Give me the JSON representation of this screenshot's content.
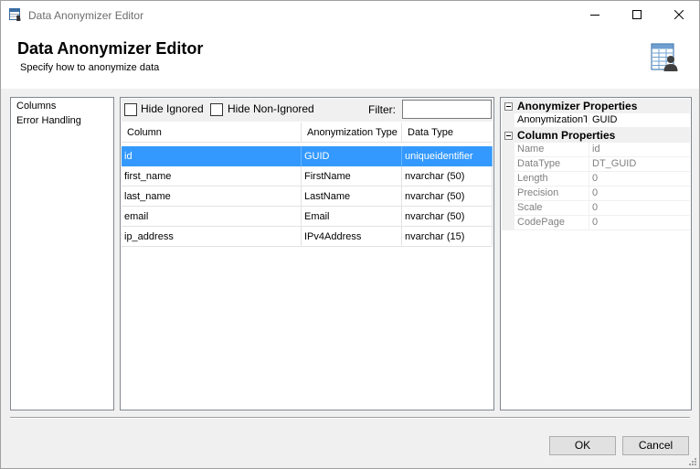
{
  "window": {
    "title": "Data Anonymizer Editor"
  },
  "header": {
    "title": "Data Anonymizer Editor",
    "subtitle": "Specify how to anonymize data"
  },
  "nav": {
    "items": [
      {
        "label": "Columns"
      },
      {
        "label": "Error Handling"
      }
    ]
  },
  "toolbar": {
    "hide_ignored_label": "Hide Ignored",
    "hide_ignored_checked": false,
    "hide_non_ignored_label": "Hide Non-Ignored",
    "hide_non_ignored_checked": false,
    "filter_label": "Filter:",
    "filter_value": ""
  },
  "table": {
    "headers": [
      "Column",
      "Anonymization Type",
      "Data Type"
    ],
    "rows": [
      {
        "column": "id",
        "anonymization_type": "GUID",
        "data_type": "uniqueidentifier",
        "selected": true
      },
      {
        "column": "first_name",
        "anonymization_type": "FirstName",
        "data_type": "nvarchar (50)",
        "selected": false
      },
      {
        "column": "last_name",
        "anonymization_type": "LastName",
        "data_type": "nvarchar (50)",
        "selected": false
      },
      {
        "column": "email",
        "anonymization_type": "Email",
        "data_type": "nvarchar (50)",
        "selected": false
      },
      {
        "column": "ip_address",
        "anonymization_type": "IPv4Address",
        "data_type": "nvarchar (15)",
        "selected": false
      }
    ]
  },
  "properties": {
    "anonymizer_category": "Anonymizer Properties",
    "anonymizer_props": [
      {
        "name": "AnonymizationTy",
        "value": "GUID"
      }
    ],
    "column_category": "Column Properties",
    "column_props": [
      {
        "name": "Name",
        "value": "id"
      },
      {
        "name": "DataType",
        "value": "DT_GUID"
      },
      {
        "name": "Length",
        "value": "0"
      },
      {
        "name": "Precision",
        "value": "0"
      },
      {
        "name": "Scale",
        "value": "0"
      },
      {
        "name": "CodePage",
        "value": "0"
      }
    ]
  },
  "buttons": {
    "ok": "OK",
    "cancel": "Cancel"
  },
  "colors": {
    "selection": "#3399ff",
    "border": "#828790",
    "background": "#f0f0f0"
  }
}
